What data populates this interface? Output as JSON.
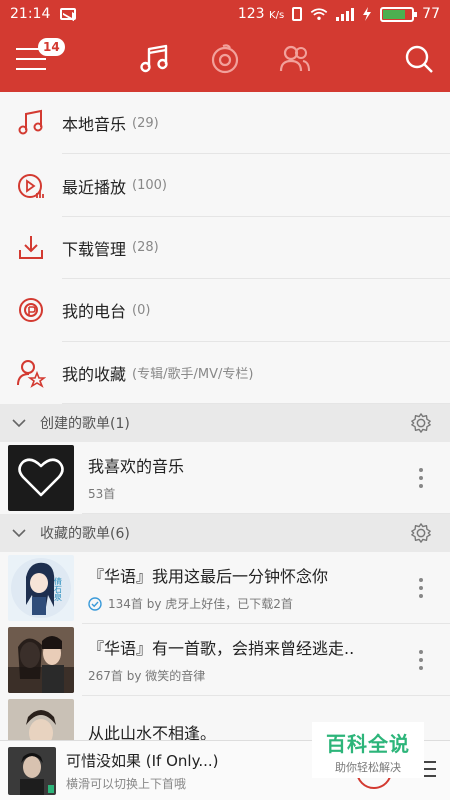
{
  "statusbar": {
    "time": "21:14",
    "speed": "123",
    "speed_unit": "K/s",
    "battery": "77",
    "battery_level": 0.77
  },
  "topbar": {
    "notification_badge": "14"
  },
  "menu": [
    {
      "label": "本地音乐",
      "count": "(29)",
      "icon": "music-note-icon"
    },
    {
      "label": "最近播放",
      "count": "(100)",
      "icon": "recent-play-icon"
    },
    {
      "label": "下载管理",
      "count": "(28)",
      "icon": "download-icon"
    },
    {
      "label": "我的电台",
      "count": "(0)",
      "icon": "radio-icon"
    },
    {
      "label": "我的收藏",
      "count": "(专辑/歌手/MV/专栏)",
      "icon": "favorites-icon"
    }
  ],
  "created_section": {
    "title": "创建的歌单(1)"
  },
  "created_playlists": [
    {
      "title": "我喜欢的音乐",
      "sub": "53首"
    }
  ],
  "collected_section": {
    "title": "收藏的歌单(6)"
  },
  "collected_playlists": [
    {
      "title": "『华语』我用这最后一分钟怀念你",
      "sub": "134首 by 虎牙上好佳，已下载2首"
    },
    {
      "title": "『华语』有一首歌，会捎来曾经逃走..",
      "sub": "267首 by 微笑的音律"
    },
    {
      "title": "从此山水不相逢。",
      "sub": ""
    }
  ],
  "cover_art_text": "倩石泉",
  "player": {
    "title": "可惜没如果 (If Only...)",
    "hint": "横滑可以切换上下首哦"
  },
  "watermark": {
    "line1": "百科全说",
    "line2": "助你轻松解决"
  },
  "colors": {
    "brand": "#d33a31",
    "watermark": "#2db57a"
  }
}
